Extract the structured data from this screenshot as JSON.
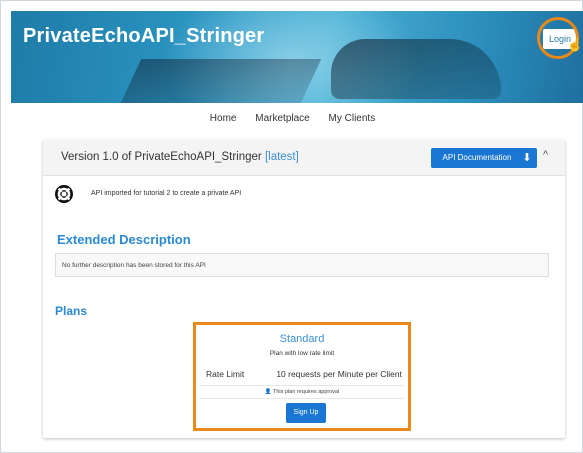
{
  "header": {
    "title": "PrivateEchoAPI_Stringer",
    "login_label": "Login"
  },
  "nav": {
    "items": [
      "Home",
      "Marketplace",
      "My Clients"
    ]
  },
  "card": {
    "version_prefix": "Version 1.0 of PrivateEchoAPI_Stringer",
    "latest_label": "[latest]",
    "api_doc_label": "API Documentation",
    "download_icon": "download-icon",
    "collapse_icon": "chevron-up-icon",
    "api_description": "API imported for tutorial 2 to create a private API",
    "extended_heading": "Extended Description",
    "extended_text": "No further description has been stored for this API",
    "plans_heading": "Plans"
  },
  "plan": {
    "name": "Standard",
    "description": "Plan with low rate limit",
    "rate_label": "Rate Limit",
    "rate_value": "10 requests per Minute per Client",
    "approval_text": "This plan requires approval",
    "signup_label": "Sign Up"
  },
  "colors": {
    "accent": "#1976d2",
    "heading": "#2a8ad4",
    "highlight": "#e8891a"
  }
}
